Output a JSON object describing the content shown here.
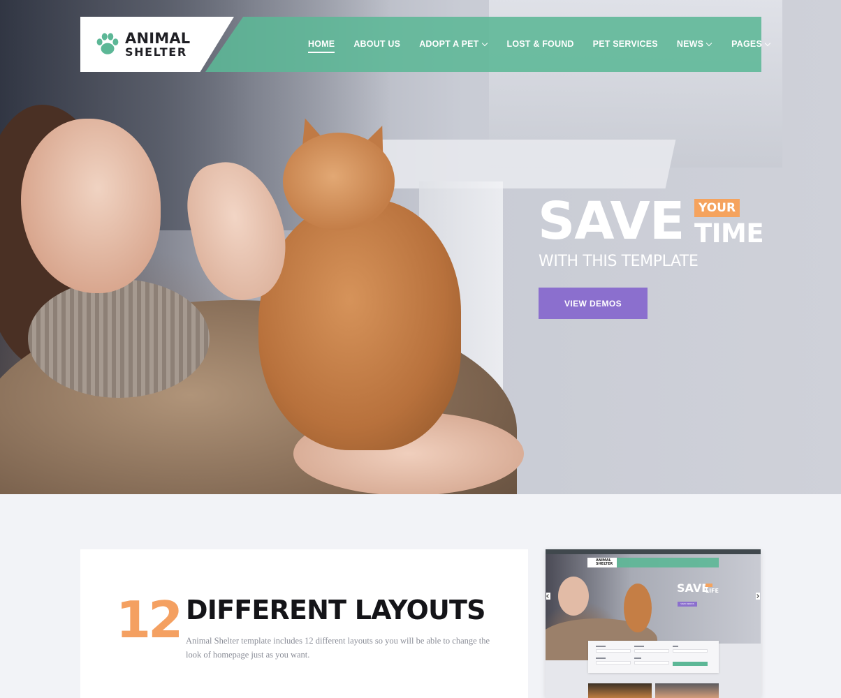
{
  "header": {
    "logo": {
      "line1": "ANIMAL",
      "line2": "SHELTER"
    },
    "nav": [
      {
        "label": "HOME",
        "active": true,
        "dropdown": false
      },
      {
        "label": "ABOUT US",
        "active": false,
        "dropdown": false
      },
      {
        "label": "ADOPT A PET",
        "active": false,
        "dropdown": true
      },
      {
        "label": "LOST & FOUND",
        "active": false,
        "dropdown": false
      },
      {
        "label": "PET SERVICES",
        "active": false,
        "dropdown": false
      },
      {
        "label": "NEWS",
        "active": false,
        "dropdown": true
      },
      {
        "label": "PAGES",
        "active": false,
        "dropdown": true
      }
    ]
  },
  "hero": {
    "title_big": "SAVE",
    "title_tag": "YOUR",
    "title_small": "TIME",
    "subtitle": "WITH THIS TEMPLATE",
    "button_label": "VIEW DEMOS"
  },
  "feature": {
    "number": "12",
    "title": "DIFFERENT LAYOUTS",
    "description": "Animal Shelter template includes 12 different layouts so you will be able to change the look of homepage just as you want."
  },
  "preview": {
    "logo_line1": "ANIMAL",
    "logo_line2": "SHELTER",
    "title_big": "SAVE",
    "title_small": "LIFE",
    "button_label": "VIEW DEMOS"
  },
  "colors": {
    "nav_green": "#5cb796",
    "accent_orange": "#f4a061",
    "button_purple": "#8b6fce",
    "page_bg": "#f2f3f7"
  },
  "icons": {
    "logo": "paw-icon",
    "dropdown": "chevron-down-icon"
  }
}
